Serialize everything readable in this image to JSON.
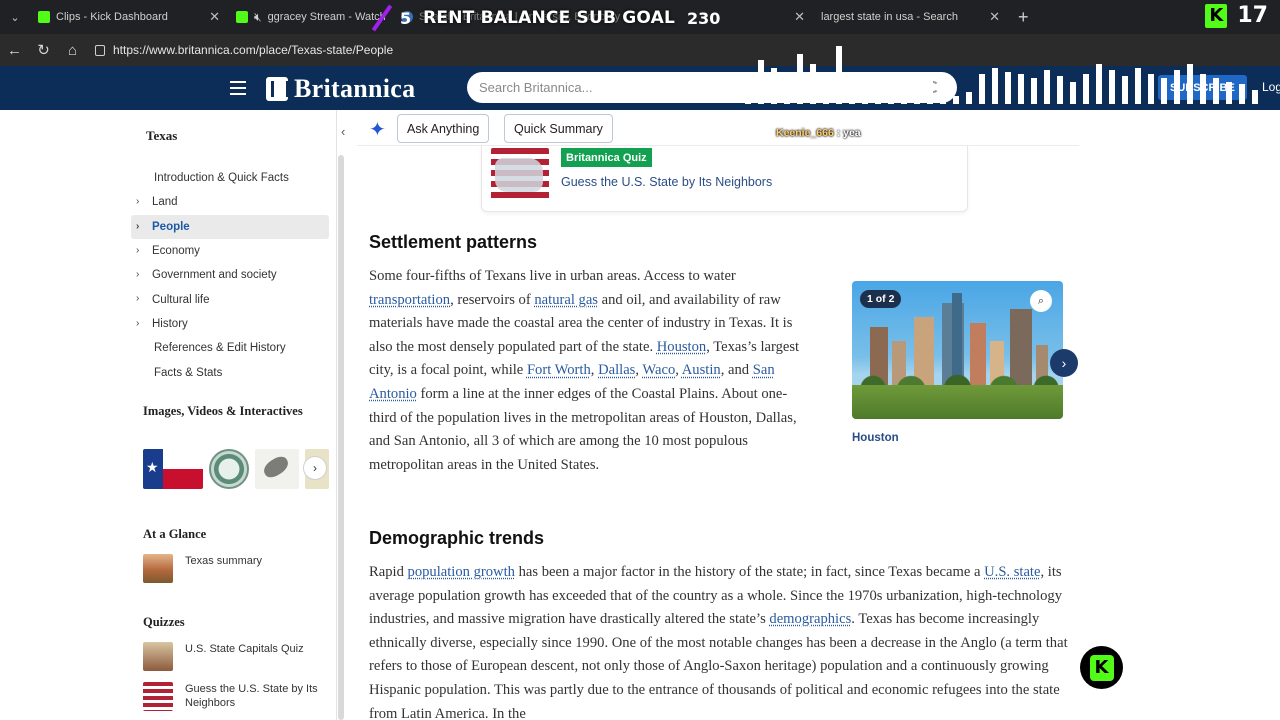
{
  "browser": {
    "tabs": [
      {
        "title": "Clips - Kick Dashboard"
      },
      {
        "title": "ggracey Stream - Watch Live"
      },
      {
        "title": "Search | Britannica | University, Economy"
      },
      {
        "title": "largest state in usa - Search"
      }
    ],
    "url": "https://www.britannica.com/place/Texas-state/People"
  },
  "overlay": {
    "goal_current": "5",
    "goal_title": "RENT BALANCE SUB GOAL",
    "goal_target": "230",
    "viewer_count": "17",
    "chat_user": "Keenie_666",
    "chat_message": " : yea",
    "kick_letter": "K"
  },
  "header": {
    "brand": "Britannica",
    "search_placeholder": "Search Britannica...",
    "subscribe": "SUBSCRIBE",
    "login": "Log"
  },
  "sidebar": {
    "title": "Texas",
    "toc": [
      {
        "label": "Introduction & Quick Facts",
        "chevron": false
      },
      {
        "label": "Land",
        "chevron": true
      },
      {
        "label": "People",
        "chevron": true,
        "active": true
      },
      {
        "label": "Economy",
        "chevron": true
      },
      {
        "label": "Government and society",
        "chevron": true
      },
      {
        "label": "Cultural life",
        "chevron": true
      },
      {
        "label": "History",
        "chevron": true
      },
      {
        "label": "References & Edit History",
        "chevron": false
      },
      {
        "label": "Facts & Stats",
        "chevron": false
      }
    ],
    "media_heading": "Images, Videos & Interactives",
    "glance_heading": "At a Glance",
    "glance_item": "Texas summary",
    "quizzes_heading": "Quizzes",
    "quizzes": [
      "U.S. State Capitals Quiz",
      "Guess the U.S. State by Its Neighbors"
    ]
  },
  "toolbar": {
    "ask": "Ask Anything",
    "summary": "Quick Summary"
  },
  "quiz_card": {
    "badge": "Britannica Quiz",
    "link": "Guess the U.S. State by Its Neighbors"
  },
  "article": {
    "settlement_heading": "Settlement patterns",
    "settlement_text": [
      {
        "t": "Some four-fifths of Texans live in urban areas. Access to water "
      },
      {
        "t": "transportation",
        "link": true
      },
      {
        "t": ", reservoirs of "
      },
      {
        "t": "natural gas",
        "link": true
      },
      {
        "t": " and oil, and availability of raw materials have made the coastal area the center of industry in Texas. It is also the most densely populated part of the state. "
      },
      {
        "t": "Houston",
        "link": true
      },
      {
        "t": ", Texas’s largest city, is a focal point, while "
      },
      {
        "t": "Fort Worth",
        "link": true
      },
      {
        "t": ", "
      },
      {
        "t": "Dallas",
        "link": true
      },
      {
        "t": ", "
      },
      {
        "t": "Waco",
        "link": true
      },
      {
        "t": ", "
      },
      {
        "t": "Austin",
        "link": true
      },
      {
        "t": ", and "
      },
      {
        "t": "San Antonio",
        "link": true
      },
      {
        "t": " form a line at the inner edges of the Coastal Plains. About one-third of the population lives in the metropolitan areas of Houston, Dallas, and San Antonio, all 3 of which are among the 10 most populous metropolitan areas in the United States."
      }
    ],
    "figure_count": "1 of 2",
    "figure_caption": "Houston",
    "demographic_heading": "Demographic trends",
    "demographic_text": [
      {
        "t": "Rapid "
      },
      {
        "t": "population growth",
        "link": true
      },
      {
        "t": " has been a major factor in the history of the state; in fact, since Texas became a "
      },
      {
        "t": "U.S. state",
        "link": true
      },
      {
        "t": ", its average population growth has exceeded that of the country as a whole. Since the 1970s urbanization, high-technology industries, and massive migration have drastically altered the state’s "
      },
      {
        "t": "demographics",
        "link": true
      },
      {
        "t": ". Texas has become increasingly ethnically diverse, especially since 1990. One of the most notable changes has been a decrease in the Anglo (a term that refers to those of European descent, not only those of Anglo-Saxon heritage) population and a continuously growing Hispanic population. This was partly due to the entrance of thousands of political and economic refugees into the state from Latin America. In the"
      }
    ]
  }
}
